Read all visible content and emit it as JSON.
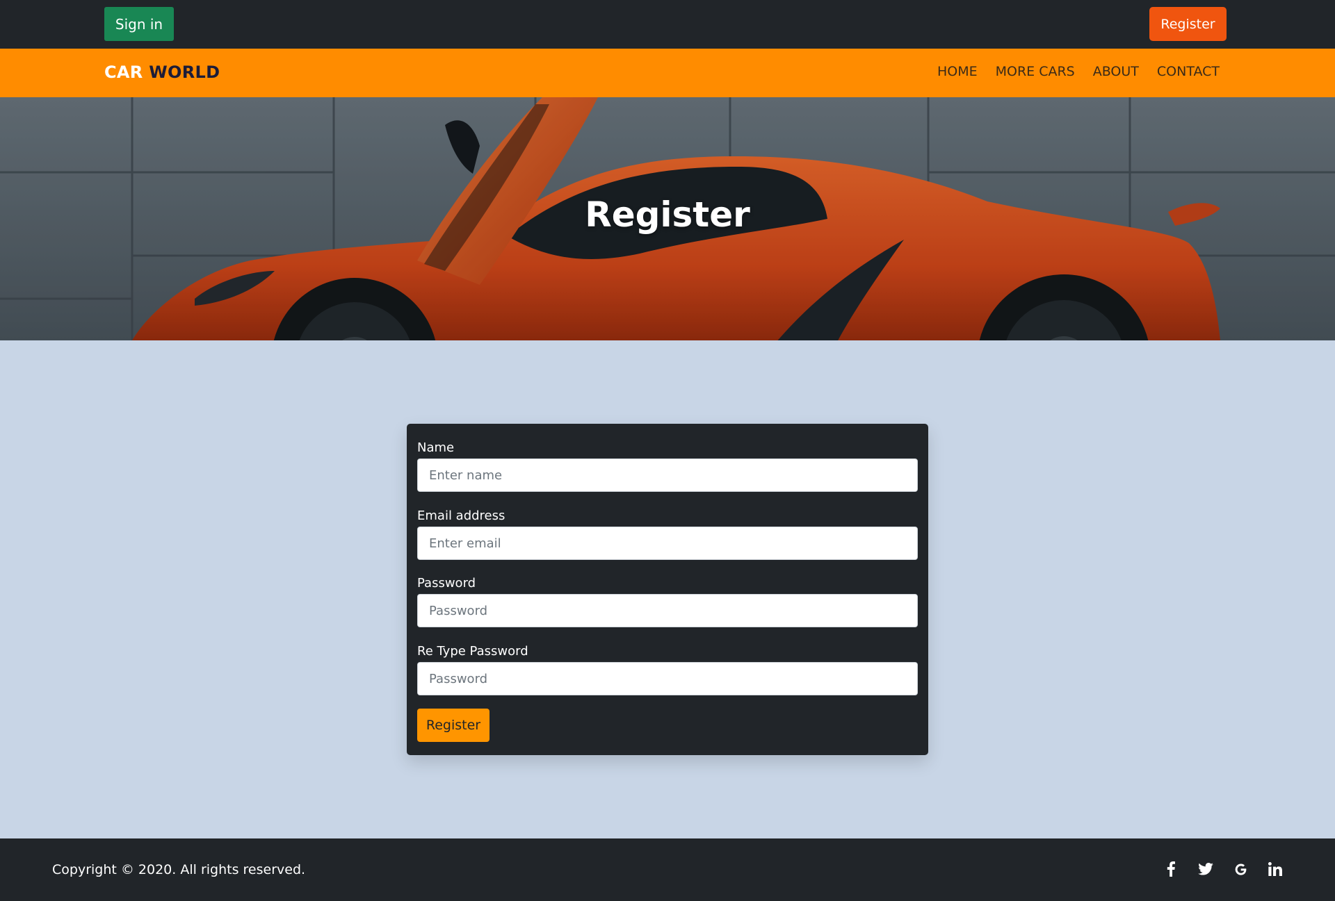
{
  "topbar": {
    "signin_label": "Sign in",
    "register_label": "Register"
  },
  "navbar": {
    "brand_part1": "CAR",
    "brand_part2": "WORLD",
    "links": [
      {
        "label": "HOME"
      },
      {
        "label": "MORE CARS"
      },
      {
        "label": "ABOUT"
      },
      {
        "label": "CONTACT"
      }
    ]
  },
  "hero": {
    "title": "Register"
  },
  "form": {
    "name_label": "Name",
    "name_placeholder": "Enter name",
    "email_label": "Email address",
    "email_placeholder": "Enter email",
    "password_label": "Password",
    "password_placeholder": "Password",
    "retype_label": "Re Type Password",
    "retype_placeholder": "Password",
    "submit_label": "Register"
  },
  "footer": {
    "copyright": "Copyright © 2020. All rights reserved.",
    "social_icons": [
      "facebook-icon",
      "twitter-icon",
      "google-icon",
      "linkedin-icon"
    ]
  },
  "colors": {
    "dark": "#212529",
    "orange_nav": "#ff8c00",
    "register_top": "#f0550f",
    "signin_green": "#198754",
    "page_bg": "#c8d5e6",
    "submit_orange": "#ff9500"
  }
}
